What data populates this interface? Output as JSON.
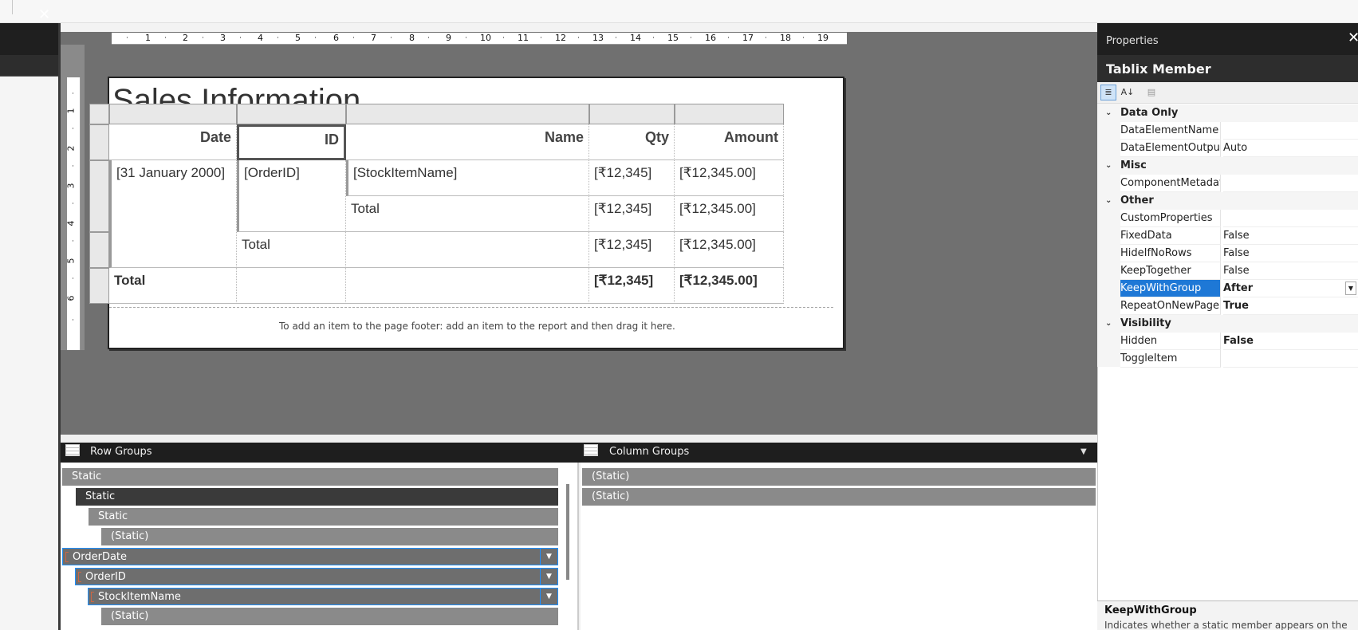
{
  "top_strip": {},
  "left_panel": {
    "close_glyph": "✕",
    "close_icon": "close-icon"
  },
  "ruler": {
    "h_ticks": [
      "1",
      "2",
      "3",
      "4",
      "5",
      "6",
      "7",
      "8",
      "9",
      "10",
      "11",
      "12",
      "13",
      "14",
      "15",
      "16",
      "17",
      "18",
      "19"
    ],
    "v_ticks": [
      "1",
      "2",
      "3",
      "4",
      "5",
      "6"
    ]
  },
  "report": {
    "title": "Sales Information",
    "footer_message": "To add an item to the page footer: add an item to the report and then drag it here.",
    "headers": [
      "Date",
      "ID",
      "Name",
      "Qty",
      "Amount"
    ],
    "rows": [
      [
        "[31 January 2000]",
        "[OrderID]",
        "[StockItemName]",
        "[₹12,345]",
        "[₹12,345.00]"
      ],
      [
        "",
        "",
        "Total",
        "[₹12,345]",
        "[₹12,345.00]"
      ],
      [
        "",
        "Total",
        "",
        "[₹12,345]",
        "[₹12,345.00]"
      ],
      [
        "Total",
        "",
        "",
        "[₹12,345]",
        "[₹12,345.00]"
      ]
    ]
  },
  "row_groups": {
    "title": "Row Groups",
    "icon": "grid-icon",
    "items": [
      "Static",
      "Static",
      "Static",
      "(Static)",
      "OrderDate",
      "OrderID",
      "StockItemName",
      "(Static)"
    ]
  },
  "column_groups": {
    "title": "Column Groups",
    "icon": "grid-icon",
    "items": [
      "(Static)",
      "(Static)"
    ]
  },
  "properties": {
    "title": "Properties",
    "close_glyph": "✕",
    "object": "Tablix Member",
    "toolbar": {
      "categorized": "≣",
      "alphabetical": "A↓",
      "pages": "▤"
    },
    "categories": [
      {
        "name": "Data Only",
        "props": [
          {
            "name": "DataElementName",
            "value": ""
          },
          {
            "name": "DataElementOutput",
            "value": "Auto"
          }
        ]
      },
      {
        "name": "Misc",
        "props": [
          {
            "name": "ComponentMetadata",
            "value": ""
          }
        ]
      },
      {
        "name": "Other",
        "props": [
          {
            "name": "CustomProperties",
            "value": ""
          },
          {
            "name": "FixedData",
            "value": "False"
          },
          {
            "name": "HideIfNoRows",
            "value": "False"
          },
          {
            "name": "KeepTogether",
            "value": "False"
          },
          {
            "name": "KeepWithGroup",
            "value": "After"
          },
          {
            "name": "RepeatOnNewPage",
            "value": "True"
          }
        ]
      },
      {
        "name": "Visibility",
        "props": [
          {
            "name": "Hidden",
            "value": "False"
          },
          {
            "name": "ToggleItem",
            "value": ""
          }
        ]
      }
    ],
    "description": {
      "title": "KeepWithGroup",
      "text": "Indicates whether a static member appears on the"
    }
  },
  "colors": {
    "selection": "#1e78d6",
    "designer_bg": "#707070",
    "panel_header": "#1f1f1f"
  }
}
